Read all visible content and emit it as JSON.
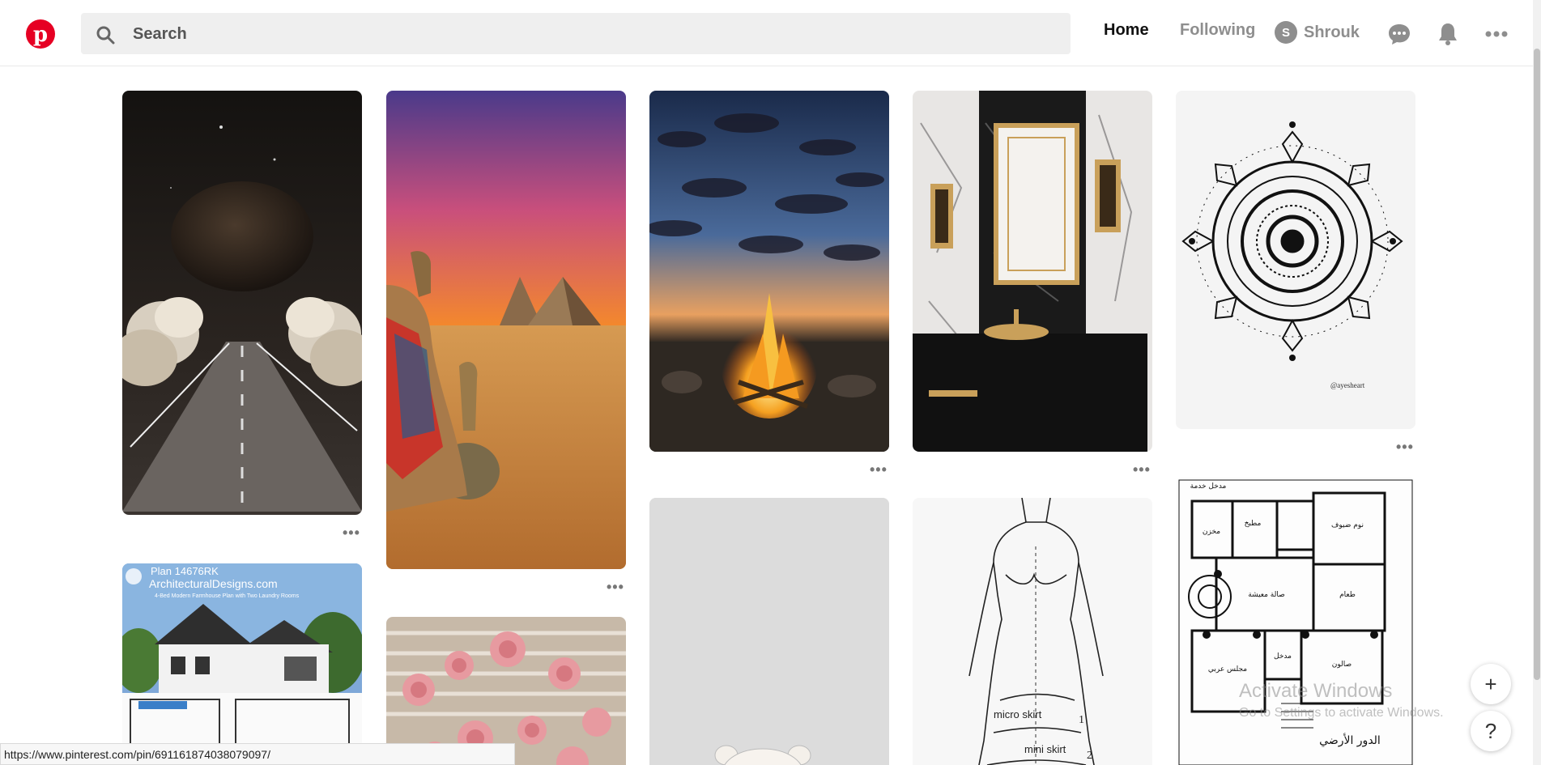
{
  "header": {
    "search_placeholder": "Search",
    "nav_home": "Home",
    "nav_following": "Following",
    "user_initial": "S",
    "user_name": "Shrouk",
    "brand_color": "#e60023",
    "icons": [
      "pinterest-logo-icon",
      "search-icon",
      "messages-icon",
      "notifications-icon",
      "more-options-icon"
    ]
  },
  "pins": [
    {
      "name": "night-road-clouds",
      "has_menu": true
    },
    {
      "name": "plan-houseplan",
      "overlay_title": "Plan 14676RK",
      "overlay_site": "ArchitecturalDesigns.com",
      "overlay_sub": "4-Bed Modern Farmhouse Plan with Two Laundry Rooms"
    },
    {
      "name": "pyramids-camel",
      "has_menu": true
    },
    {
      "name": "hanging-roses"
    },
    {
      "name": "desert-campfire",
      "has_menu": true
    },
    {
      "name": "gray-teddy-bear"
    },
    {
      "name": "marble-bathroom",
      "has_menu": true
    },
    {
      "name": "fashion-sketch",
      "label1": "micro skirt",
      "label2": "mini skirt",
      "num1": "1",
      "num2": "2"
    },
    {
      "name": "mandala-drawing",
      "signature": "@ayesheart",
      "has_menu": true
    },
    {
      "name": "arabic-floorplan",
      "rooms": [
        "مدخل خدمة",
        "مطبخ",
        "مخزن",
        "نوم ضيوف",
        "صالة معيشة",
        "طعام",
        "مدخل",
        "مجلس عربي",
        "صالون",
        "الدور الأرضي"
      ]
    }
  ],
  "menu_dots": "•••",
  "status_url": "https://www.pinterest.com/pin/691161874038079097/",
  "fab": {
    "add": "+",
    "help": "?"
  },
  "watermark": {
    "line1": "Activate Windows",
    "line2": "Go to Settings to activate Windows."
  }
}
